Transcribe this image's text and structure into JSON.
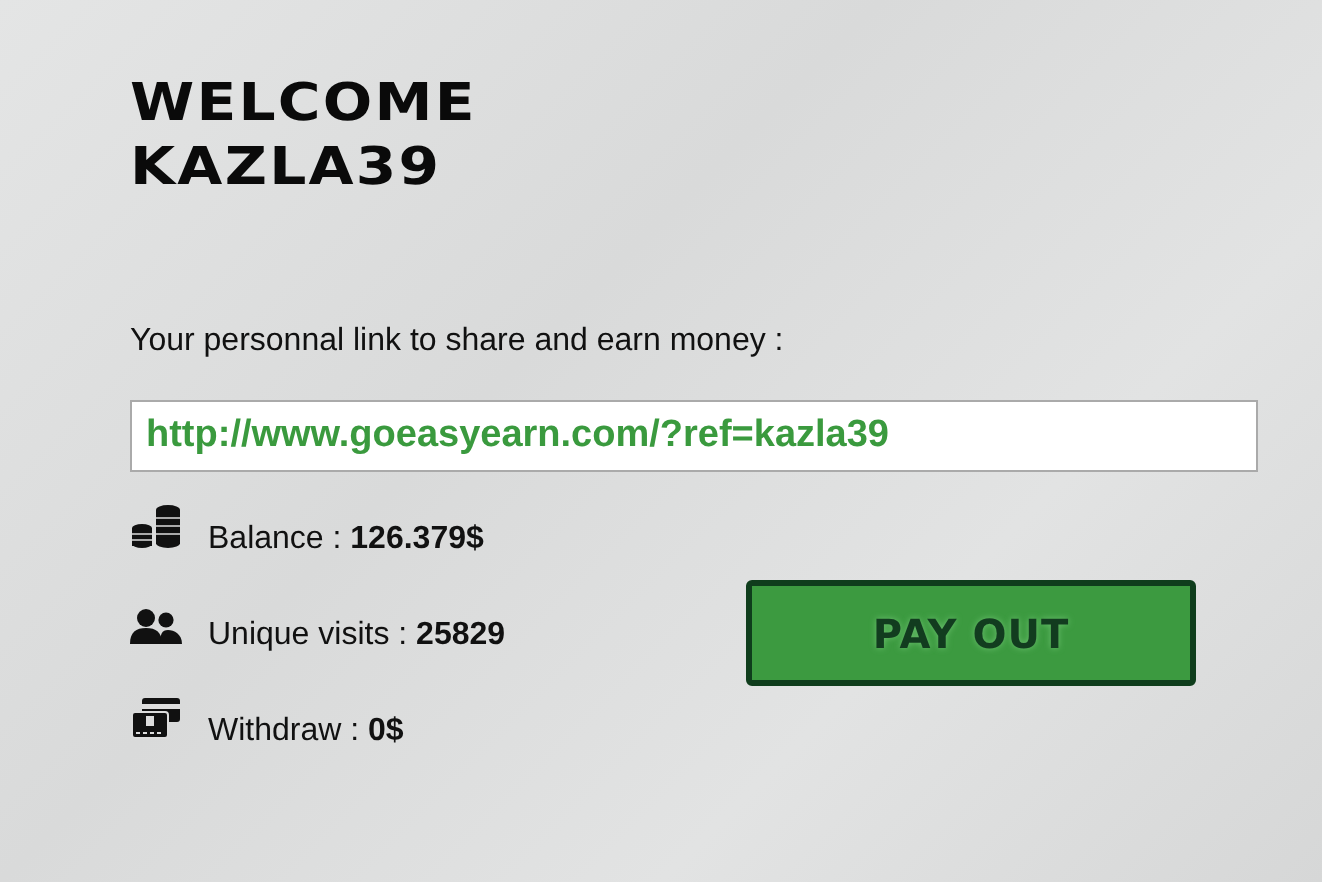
{
  "title": "WELCOME KAZLA39",
  "link_label": "Your personnal link to share and earn money :",
  "link_field": {
    "value": "http://www.goeasyearn.com/?ref=kazla39"
  },
  "stats": [
    {
      "kind": "coins",
      "text": "Balance : **126.379$**"
    },
    {
      "kind": "users",
      "text": "Unique visits : **25829**"
    },
    {
      "kind": "card",
      "text": "Withdraw : **0$**"
    }
  ],
  "button": "PAY OUT"
}
